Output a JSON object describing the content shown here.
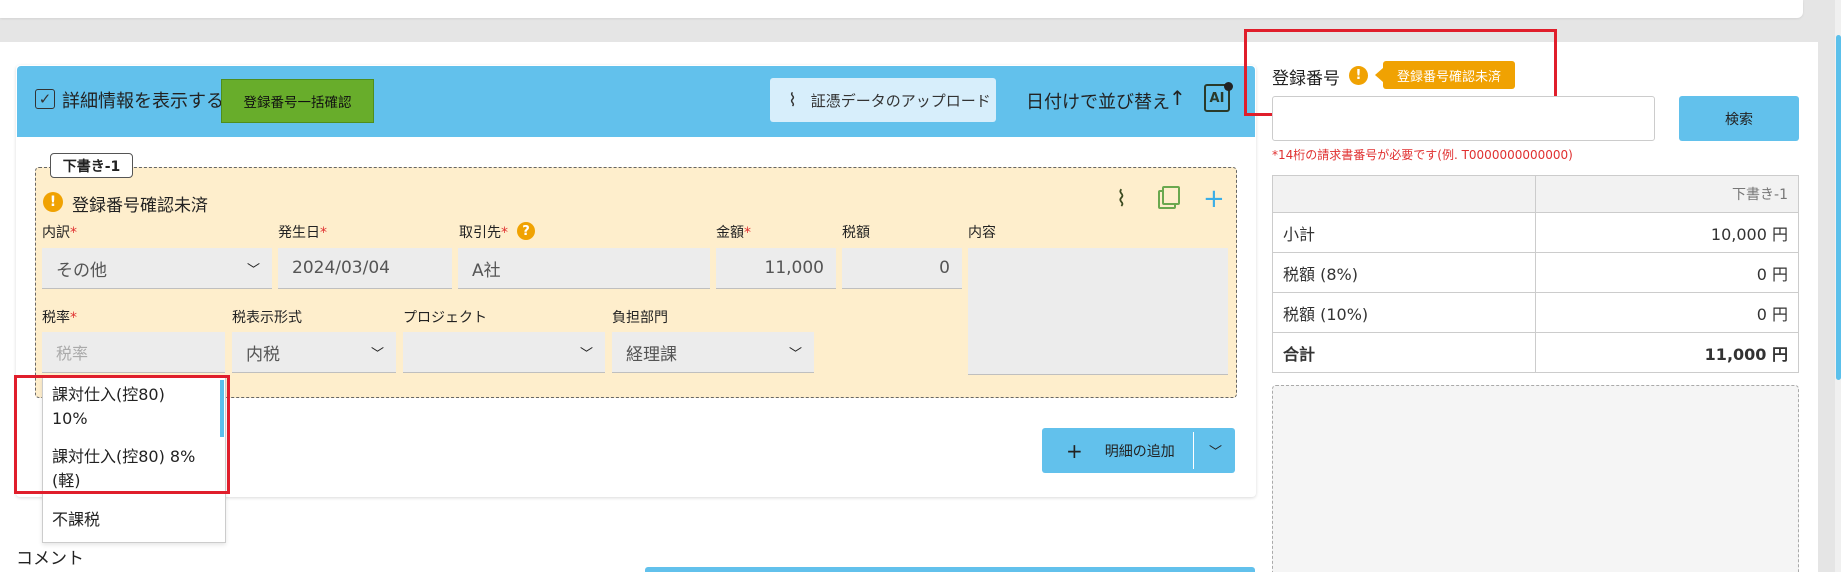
{
  "toolbar": {
    "show_details_label": "詳細情報を表示する",
    "bulk_check_button": "登録番号一括確認",
    "upload_button": "証憑データのアップロード",
    "sort_label": "日付けで並び替え",
    "sort_arrow": "↑",
    "ai_label": "AI"
  },
  "draft": {
    "tab_label": "下書き-1",
    "warning_text": "登録番号確認未済",
    "fields": {
      "category": {
        "label": "内訳",
        "value": "その他"
      },
      "date": {
        "label": "発生日",
        "value": "2024/03/04"
      },
      "partner": {
        "label": "取引先",
        "value": "A社"
      },
      "amount": {
        "label": "金額",
        "value": "11,000"
      },
      "tax_amount": {
        "label": "税額",
        "value": "0"
      },
      "content": {
        "label": "内容",
        "value": ""
      },
      "tax_rate": {
        "label": "税率",
        "placeholder": "税率"
      },
      "tax_display": {
        "label": "税表示形式",
        "value": "内税"
      },
      "project": {
        "label": "プロジェクト",
        "value": ""
      },
      "department": {
        "label": "負担部門",
        "value": "経理課"
      }
    },
    "required_mark": "*"
  },
  "tax_rate_dropdown": {
    "options": [
      {
        "line1": "課対仕入(控80)",
        "line2": "10%"
      },
      {
        "line1": "課対仕入(控80) 8%",
        "line2": "(軽)"
      },
      {
        "line1": "不課税",
        "line2": ""
      }
    ]
  },
  "add_line_button": "明細の追加",
  "comment_label": "コメント",
  "registration": {
    "label": "登録番号",
    "tooltip": "登録番号確認未済",
    "input_value": "",
    "search_button": "検索",
    "hint": "*14桁の請求書番号が必要です(例. T0000000000000)"
  },
  "summary": {
    "header": "下書き-1",
    "rows": [
      {
        "label": "小計",
        "value": "10,000 円"
      },
      {
        "label": "税額 (8%)",
        "value": "0 円"
      },
      {
        "label": "税額 (10%)",
        "value": "0 円"
      },
      {
        "label": "合計",
        "value": "11,000 円"
      }
    ]
  },
  "colors": {
    "accent_blue": "#62c1ec",
    "green_button": "#68ad2b",
    "warning_orange": "#f0a202",
    "draft_bg": "#feeecc",
    "highlight_red": "#e01e2b"
  }
}
